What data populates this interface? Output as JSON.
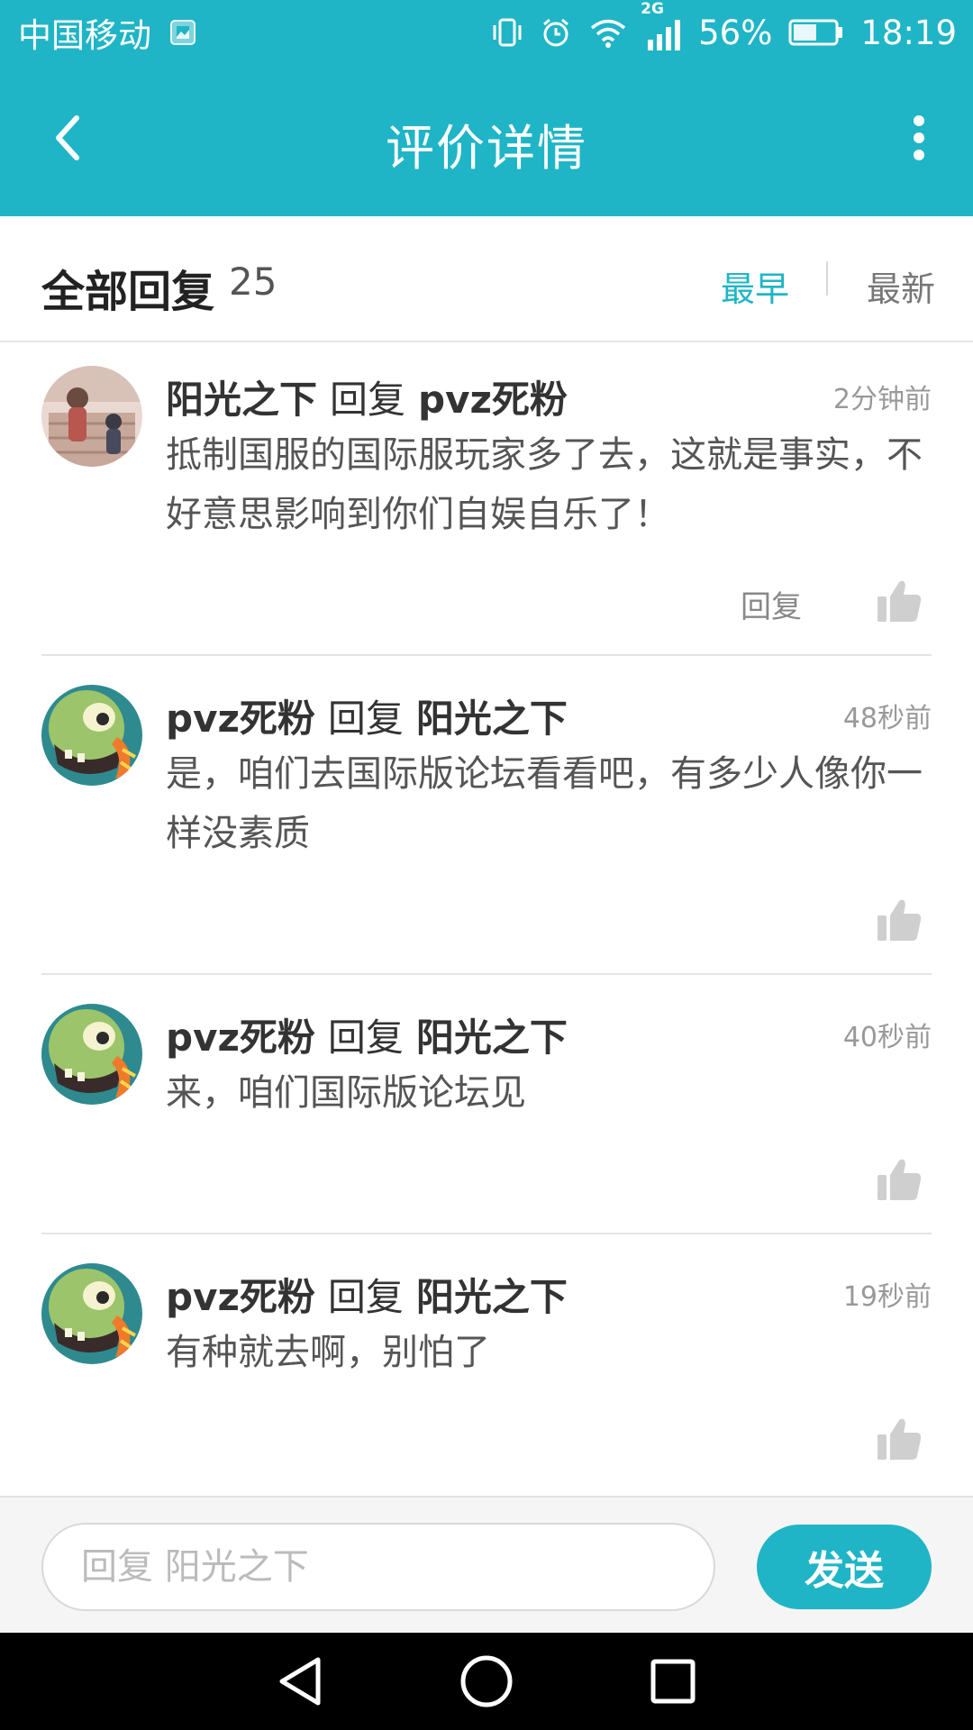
{
  "status_bar": {
    "carrier": "中国移动",
    "network": "2G",
    "battery": "56%",
    "battery_level": 0.56,
    "time": "18:19",
    "icons": [
      "gallery-icon",
      "vibrate-icon",
      "alarm-icon",
      "wifi-icon",
      "signal-icon",
      "battery-icon"
    ]
  },
  "header": {
    "title": "评价详情",
    "back_icon": "back-arrow-icon",
    "more_icon": "more-vertical-icon"
  },
  "section": {
    "title": "全部回复",
    "count": "25",
    "sort_options": [
      "最早",
      "最新"
    ],
    "active_sort": "最早"
  },
  "comments": [
    {
      "author": "阳光之下",
      "reply_word": "回复",
      "target": "pvz死粉",
      "time": "2分钟前",
      "text": "抵制国服的国际服玩家多了去，这就是事实，不好意思影响到你们自娱自乐了！",
      "reply_label": "回复",
      "avatar": "girl-illustration-avatar"
    },
    {
      "author": "pvz死粉",
      "reply_word": "回复",
      "target": "阳光之下",
      "time": "48秒前",
      "text": "是，咱们去国际版论坛看看吧，有多少人像你一样没素质",
      "avatar": "zombie-avatar"
    },
    {
      "author": "pvz死粉",
      "reply_word": "回复",
      "target": "阳光之下",
      "time": "40秒前",
      "text": "来，咱们国际版论坛见",
      "avatar": "zombie-avatar"
    },
    {
      "author": "pvz死粉",
      "reply_word": "回复",
      "target": "阳光之下",
      "time": "19秒前",
      "text": "有种就去啊，别怕了",
      "avatar": "zombie-avatar"
    }
  ],
  "input_bar": {
    "placeholder": "回复 阳光之下",
    "value": "",
    "send_label": "发送"
  },
  "nav_bar": {
    "buttons": [
      "back-triangle-icon",
      "home-circle-icon",
      "recents-square-icon"
    ]
  },
  "colors": {
    "accent": "#1fb5c6",
    "text_primary": "#333333",
    "text_secondary": "#999999"
  }
}
